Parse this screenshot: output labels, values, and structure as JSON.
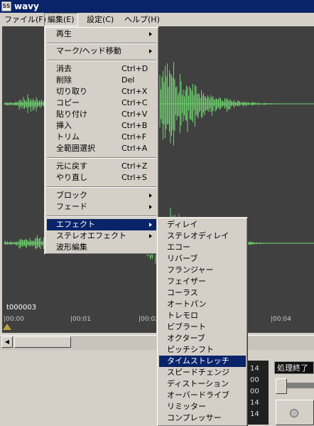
{
  "window": {
    "title": "wavy",
    "icon": "app-icon-wave"
  },
  "menubar": [
    {
      "label": "ファイル(F)"
    },
    {
      "label": "編集(E)"
    },
    {
      "label": "設定(C)"
    },
    {
      "label": "ヘルプ(H)"
    }
  ],
  "edit_menu": {
    "play": "再生",
    "mark_move": "マーク/ヘッド移動",
    "delete": "消去",
    "delete_sc": "Ctrl+D",
    "remove": "削除",
    "remove_sc": "Del",
    "cut": "切り取り",
    "cut_sc": "Ctrl+X",
    "copy": "コピー",
    "copy_sc": "Ctrl+C",
    "paste": "貼り付け",
    "paste_sc": "Ctrl+V",
    "insert": "挿入",
    "insert_sc": "Ctrl+B",
    "trim": "トリム",
    "trim_sc": "Ctrl+F",
    "select_all": "全範囲選択",
    "select_all_sc": "Ctrl+A",
    "undo": "元に戻す",
    "undo_sc": "Ctrl+Z",
    "redo": "やり直し",
    "redo_sc": "Ctrl+S",
    "block": "ブロック",
    "fade": "フェード",
    "effect": "エフェクト",
    "stereo_effect": "ステレオエフェクト",
    "waveform_edit": "波形編集"
  },
  "effect_submenu": [
    "ディレイ",
    "ステレオディレイ",
    "エコー",
    "リバーブ",
    "フランジャー",
    "フェイザー",
    "コーラス",
    "オートパン",
    "トレモロ",
    "ビブラート",
    "オクターブ",
    "ピッチシフト",
    "タイムストレッチ",
    "スピードチェンジ",
    "ディストーション",
    "オーバードライブ",
    "リミッター",
    "コンプレッサー"
  ],
  "effect_selected": "タイムストレッチ",
  "track": {
    "label": "t000003"
  },
  "ruler": [
    "|00:00",
    "|00:01",
    "|00:02",
    "|00:04"
  ],
  "time_values": [
    "14",
    "00",
    "00",
    "14",
    "14"
  ],
  "status": {
    "text": "処理終了"
  },
  "colors": {
    "waveform": "#6fd46f",
    "title_bar": "#0a246a",
    "menu_highlight": "#0a246a"
  }
}
